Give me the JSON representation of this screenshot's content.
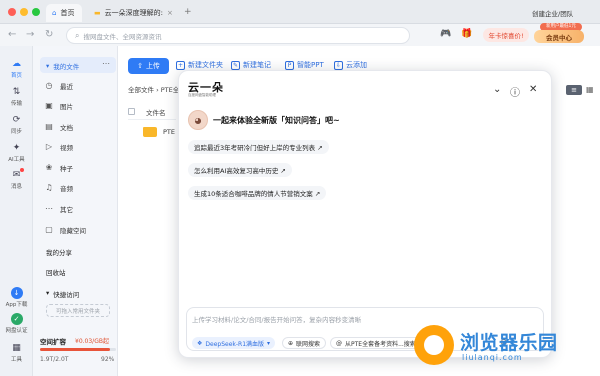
{
  "window": {
    "tabs": [
      {
        "label": "首页",
        "active": true
      },
      {
        "label": "云一朵深度理解的:",
        "active": false
      }
    ],
    "new_tab": "+",
    "user_label": "创建企业/团队"
  },
  "toolbar": {
    "search_placeholder": "搜网盘文件、全网资源资讯",
    "promo_label": "年卡惊喜价!",
    "member_label": "会员中心",
    "member_badge": "新用户最低1元"
  },
  "rail": {
    "items": [
      {
        "label": "首页",
        "icon": "home-icon"
      },
      {
        "label": "传输",
        "icon": "transfer-icon"
      },
      {
        "label": "同步",
        "icon": "sync-icon"
      },
      {
        "label": "AI工具",
        "icon": "ai-tools-icon"
      },
      {
        "label": "消息",
        "icon": "message-icon"
      },
      {
        "label": "App下载",
        "icon": "app-download-icon"
      },
      {
        "label": "网盘认证",
        "icon": "verify-icon"
      },
      {
        "label": "工具",
        "icon": "tools-icon"
      }
    ]
  },
  "sidebar": {
    "my_files": "我的文件",
    "items": [
      {
        "label": "最近",
        "icon": "clock-icon"
      },
      {
        "label": "图片",
        "icon": "image-icon"
      },
      {
        "label": "文档",
        "icon": "document-icon"
      },
      {
        "label": "视频",
        "icon": "video-icon"
      },
      {
        "label": "种子",
        "icon": "seed-icon"
      },
      {
        "label": "音频",
        "icon": "audio-icon"
      },
      {
        "label": "其它",
        "icon": "more-icon"
      },
      {
        "label": "隐藏空间",
        "icon": "hidden-space-icon"
      }
    ],
    "my_share": "我的分享",
    "recycle": "回收站",
    "quick_access": "快捷访问",
    "quick_hint": "可拖入常用文件夹",
    "storage_label": "空间扩容",
    "storage_promo": "¥0.03/GB起",
    "storage_used": "1.9T/2.0T",
    "storage_percent": "92%",
    "storage_fraction": 0.92
  },
  "main": {
    "upload": "上传",
    "actions": [
      "新建文件夹",
      "新建笔记",
      "智能PPT",
      "云添加"
    ],
    "breadcrumb": "全部文件 › PTE全",
    "column_filename": "文件名",
    "folder_name": "PTE"
  },
  "assistant": {
    "logo": "云一朵",
    "logo_sub": "百度网盘智能助理",
    "welcome": "一起来体验全新版「知识问答」吧~",
    "suggestions": [
      "追踪最近3年考研冷门但好上岸的专业列表 ↗",
      "怎么利用AI高效复习高中历史 ↗",
      "生成10条适合咖啡品牌的情人节营销文案 ↗"
    ],
    "input_placeholder": "上传学习材料/论文/合同/报告开始问答，复杂内容秒变清晰",
    "model_chip": "DeepSeek-R1满血版",
    "web_chip": "联网搜索",
    "file_chip": "从PTE全套备考资料...搜索"
  },
  "watermark": {
    "title": "浏览器乐园",
    "url": "liulanqi.com"
  }
}
